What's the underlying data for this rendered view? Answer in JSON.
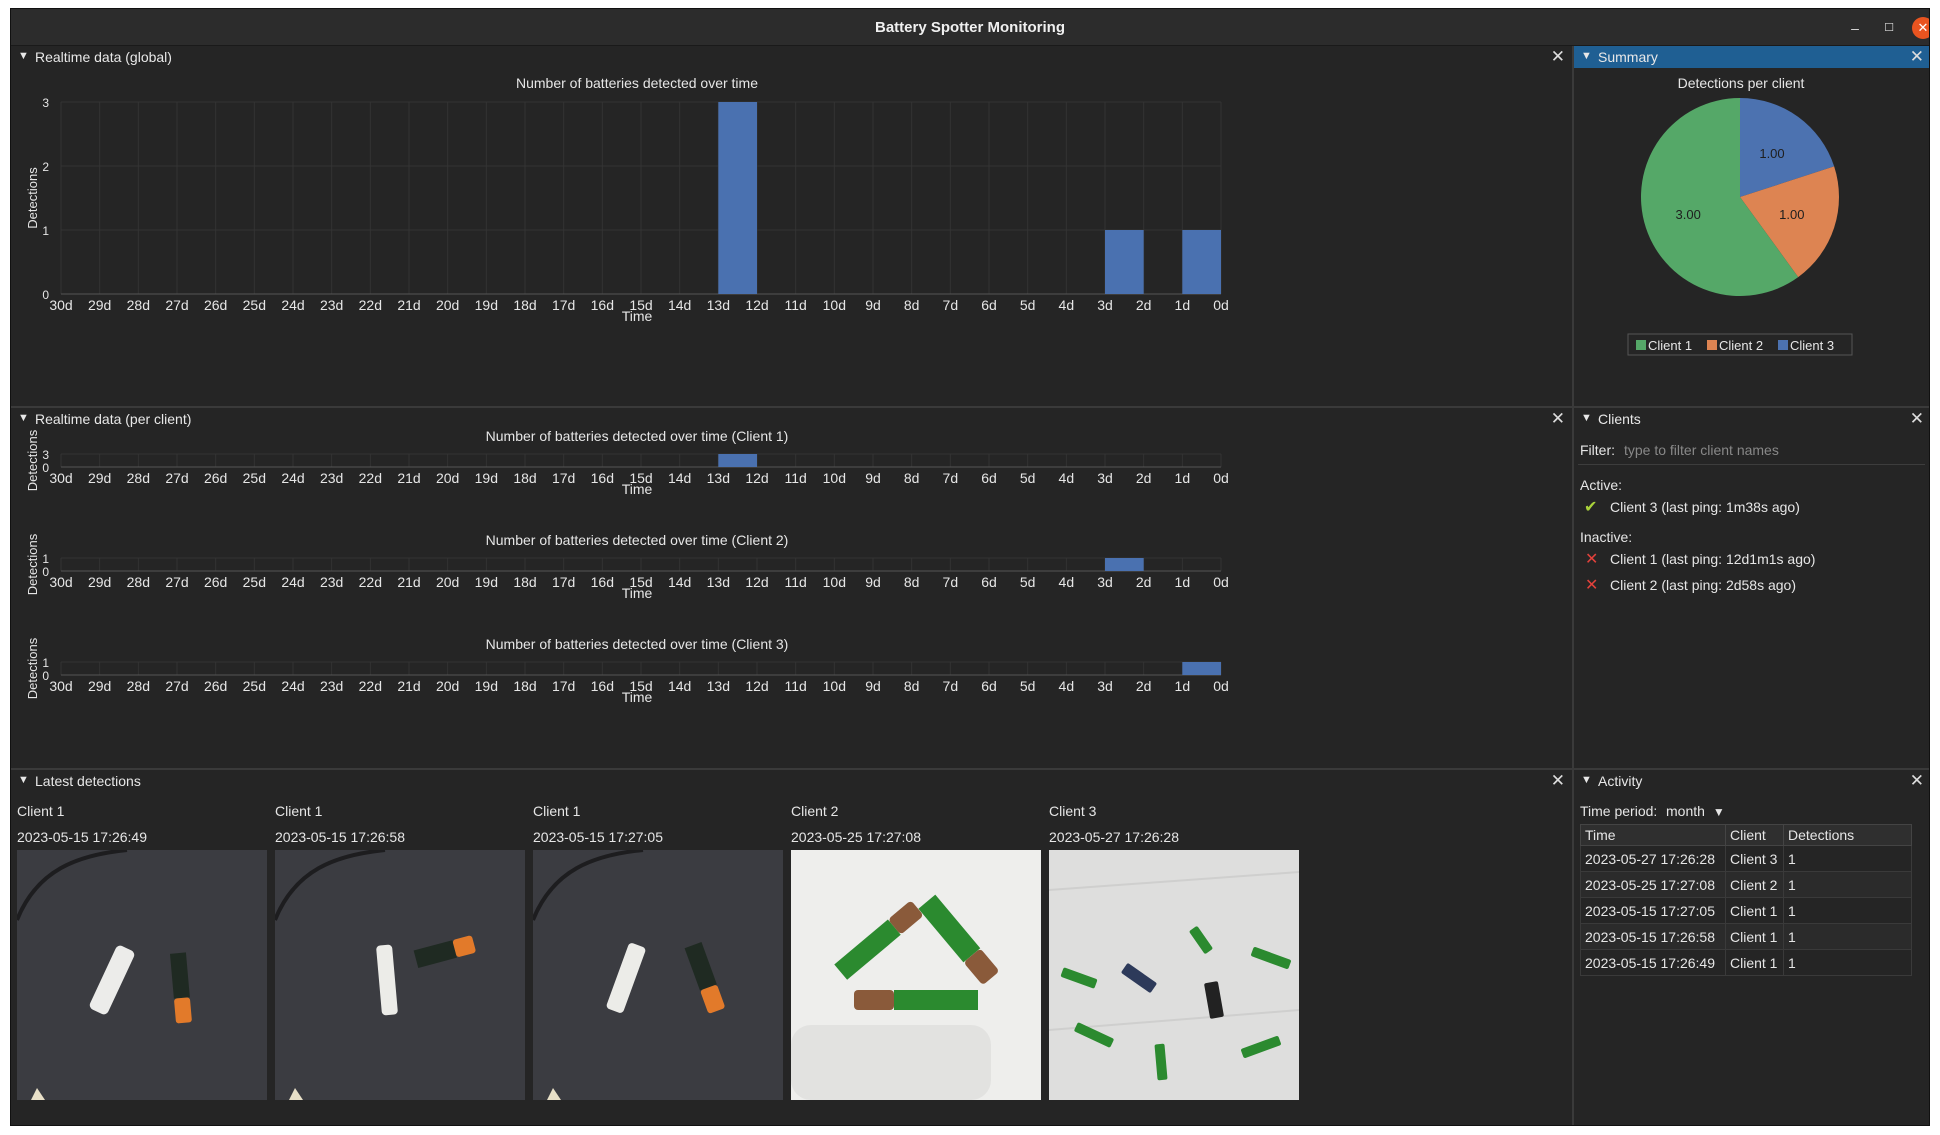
{
  "window": {
    "title": "Battery Spotter Monitoring",
    "min_icon": "minimize-icon",
    "max_icon": "maximize-icon",
    "close_icon": "close-icon"
  },
  "panels": {
    "global": {
      "title": "Realtime data (global)"
    },
    "per_client": {
      "title": "Realtime data (per client)"
    },
    "latest": {
      "title": "Latest detections"
    },
    "summary": {
      "title": "Summary"
    },
    "clients": {
      "title": "Clients"
    },
    "activity": {
      "title": "Activity"
    }
  },
  "colors": {
    "bar": "#4a71b0",
    "client1": "#55a868",
    "client2": "#dd8452",
    "client3": "#4c72b0",
    "accent": "#1f5f93",
    "ok": "#a9d23a",
    "bad": "#e2413b"
  },
  "chart_data": [
    {
      "type": "bar",
      "title": "Number of batteries detected over time",
      "xlabel": "Time",
      "ylabel": "Detections",
      "ticks": [
        "30d",
        "29d",
        "28d",
        "27d",
        "26d",
        "25d",
        "24d",
        "23d",
        "22d",
        "21d",
        "20d",
        "19d",
        "18d",
        "17d",
        "16d",
        "15d",
        "14d",
        "13d",
        "12d",
        "11d",
        "10d",
        "9d",
        "8d",
        "7d",
        "6d",
        "5d",
        "4d",
        "3d",
        "2d",
        "1d",
        "0d"
      ],
      "yticks": [
        "0",
        "1",
        "2",
        "3"
      ],
      "ylim": [
        0,
        3
      ],
      "bars": [
        {
          "from": "13d",
          "to": "12d",
          "value": 3
        },
        {
          "from": "3d",
          "to": "2d",
          "value": 1
        },
        {
          "from": "1d",
          "to": "0d",
          "value": 1
        }
      ]
    },
    {
      "type": "bar",
      "title": "Number of batteries detected over time (Client 1)",
      "xlabel": "Time",
      "ylabel": "Detections",
      "yticks": [
        "0",
        "3"
      ],
      "ylim": [
        0,
        3
      ],
      "bars": [
        {
          "from": "13d",
          "to": "12d",
          "value": 3
        }
      ]
    },
    {
      "type": "bar",
      "title": "Number of batteries detected over time (Client 2)",
      "xlabel": "Time",
      "ylabel": "Detections",
      "yticks": [
        "0",
        "1"
      ],
      "ylim": [
        0,
        1
      ],
      "bars": [
        {
          "from": "3d",
          "to": "2d",
          "value": 1
        }
      ]
    },
    {
      "type": "bar",
      "title": "Number of batteries detected over time (Client 3)",
      "xlabel": "Time",
      "ylabel": "Detections",
      "yticks": [
        "0",
        "1"
      ],
      "ylim": [
        0,
        1
      ],
      "bars": [
        {
          "from": "1d",
          "to": "0d",
          "value": 1
        }
      ]
    },
    {
      "type": "pie",
      "title": "Detections per client",
      "legend": [
        "Client 1",
        "Client 2",
        "Client 3"
      ],
      "slices": [
        {
          "name": "Client 1",
          "value": 3,
          "label": "3.00"
        },
        {
          "name": "Client 2",
          "value": 1,
          "label": "1.00"
        },
        {
          "name": "Client 3",
          "value": 1,
          "label": "1.00"
        }
      ],
      "legend_position": "bottom"
    }
  ],
  "clients": {
    "filter_label": "Filter:",
    "filter_placeholder": "type to filter client names",
    "active_label": "Active:",
    "inactive_label": "Inactive:",
    "active": [
      {
        "text": "Client 3 (last ping: 1m38s ago)",
        "icon": "check-icon"
      }
    ],
    "inactive": [
      {
        "text": "Client 1 (last ping: 12d1m1s ago)",
        "icon": "cross-icon"
      },
      {
        "text": "Client 2 (last ping: 2d58s ago)",
        "icon": "cross-icon"
      }
    ]
  },
  "latest": [
    {
      "client": "Client 1",
      "time": "2023-05-15 17:26:49"
    },
    {
      "client": "Client 1",
      "time": "2023-05-15 17:26:58"
    },
    {
      "client": "Client 1",
      "time": "2023-05-15 17:27:05"
    },
    {
      "client": "Client 2",
      "time": "2023-05-25 17:27:08"
    },
    {
      "client": "Client 3",
      "time": "2023-05-27 17:26:28"
    }
  ],
  "activity": {
    "period_label": "Time period:",
    "period_value": "month",
    "columns": [
      "Time",
      "Client",
      "Detections"
    ],
    "rows": [
      [
        "2023-05-27 17:26:28",
        "Client 3",
        "1"
      ],
      [
        "2023-05-25 17:27:08",
        "Client 2",
        "1"
      ],
      [
        "2023-05-15 17:27:05",
        "Client 1",
        "1"
      ],
      [
        "2023-05-15 17:26:58",
        "Client 1",
        "1"
      ],
      [
        "2023-05-15 17:26:49",
        "Client 1",
        "1"
      ]
    ]
  }
}
